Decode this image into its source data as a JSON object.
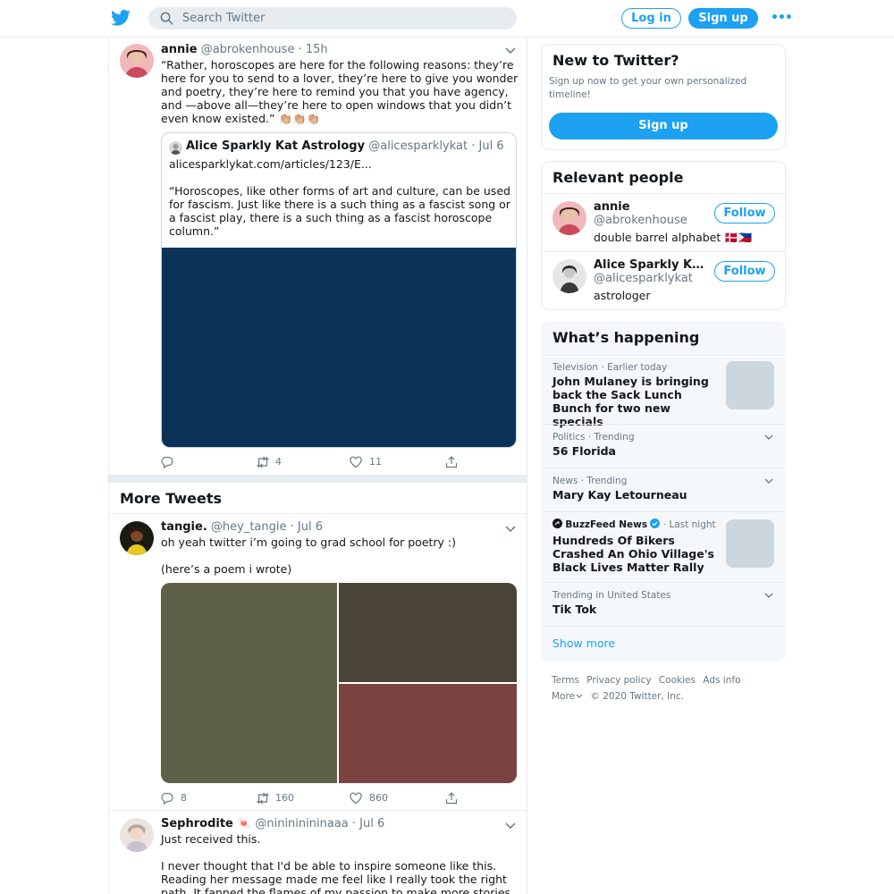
{
  "header": {
    "search_placeholder": "Search Twitter",
    "login_label": "Log in",
    "signup_label": "Sign up",
    "more_icon": "more-dots-icon",
    "brand_color": "#1da1f2"
  },
  "main_tweet": {
    "name": "annie",
    "handle": "@abrokenhouse",
    "time": "· 15h",
    "text": "“Rather, horoscopes are here for the following reasons: they’re here for you to send to a lover, they’re here to give you wonder and poetry, they’re here to remind you that you have agency, and —above all—they’re here to open windows that you didn’t even know existed.” 👏🏼👏🏼👏🏼",
    "quote": {
      "name": "Alice Sparkly Kat Astrology",
      "handle": "@alicesparklykat",
      "time": "· Jul 6",
      "text": "alicesparklykat.com/articles/123/E...\n\n“Horoscopes, like other forms of art and culture, can be used for fascism. Just like there is a such thing as a fascist song or a fascist play, there is a such thing as a fascist horoscope column.”"
    },
    "replies": "",
    "retweets": "4",
    "likes": "11"
  },
  "more_tweets_title": "More Tweets",
  "more_tweets": [
    {
      "name": "tangie.",
      "handle": "@hey_tangie",
      "time": "· Jul 6",
      "text": "oh yeah twitter i’m going to grad school for poetry :)\n\n(here’s a poem i wrote)",
      "replies": "8",
      "retweets": "160",
      "likes": "860"
    },
    {
      "name": "Sephrodite",
      "name_emoji": "🍬",
      "handle": "@ninininininaaa",
      "time": "· Jul 6",
      "text": "Just received this.\n\nI never thought that I'd be able to inspire someone like this. Reading her message made me feel like I really took the right path. It fanned the flames of my passion to make more stories & inspire"
    }
  ],
  "sidebar": {
    "new_to_twitter": {
      "title": "New to Twitter?",
      "desc": "Sign up now to get your own personalized timeline!",
      "button": "Sign up"
    },
    "relevant_people": {
      "title": "Relevant people",
      "people": [
        {
          "name": "annie",
          "handle": "@abrokenhouse",
          "bio": "double barrel alphabet 🇩🇰🇵🇭",
          "follow": "Follow"
        },
        {
          "name": "Alice Sparkly Kat...",
          "handle": "@alicesparklykat",
          "bio": "astrologer",
          "follow": "Follow"
        }
      ]
    },
    "whats_happening": {
      "title": "What’s happening",
      "trends": [
        {
          "meta": "Television · Earlier today",
          "title": "John Mulaney is bringing back the Sack Lunch Bunch for two new specials"
        },
        {
          "meta": "Politics · Trending",
          "title": "56 Florida"
        },
        {
          "meta": "News · Trending",
          "title": "Mary Kay Letourneau"
        },
        {
          "source": "BuzzFeed News",
          "meta": "· Last night",
          "title": "Hundreds Of Bikers Crashed An Ohio Village's Black Lives Matter Rally"
        },
        {
          "meta": "Trending in United States",
          "title": "Tik Tok"
        }
      ],
      "show_more": "Show more"
    },
    "footer": {
      "links": [
        "Terms",
        "Privacy policy",
        "Cookies",
        "Ads info"
      ],
      "more": "More",
      "copyright": "© 2020 Twitter, Inc."
    }
  }
}
